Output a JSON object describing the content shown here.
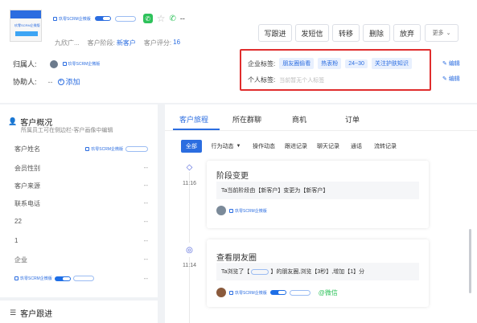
{
  "header": {
    "customer_short_name": "九欣广...",
    "stage_label": "客户阶段:",
    "stage_value": "新客户",
    "rating_label": "客户评分:",
    "rating_value": "16",
    "dash": "--",
    "avatar_text": "玖零SCRM企微版",
    "wecom_tag_text": "玖零SCRM企微版"
  },
  "owner": {
    "owner_label": "归属人:",
    "owner_tag_text": "玖零SCRM企微版",
    "assist_label": "协助人:",
    "assist_value": "--",
    "add_label": "添加"
  },
  "actions": {
    "buttons": [
      "写跟进",
      "发短信",
      "转移",
      "删除",
      "放弃"
    ],
    "more_label": "更多"
  },
  "tags": {
    "company_label": "企业标签:",
    "company_tags": [
      "朋友圈偷看",
      "热衷粉",
      "24~30",
      "关注护肤知识"
    ],
    "personal_label": "个人标签:",
    "personal_placeholder": "当前暂无个人标签",
    "edit_label": "编辑"
  },
  "overview": {
    "title": "客户概况",
    "subtitle": "所属员工可在侧边栏-客户画像中编辑",
    "rows": [
      {
        "label": "客户姓名",
        "value": ""
      },
      {
        "label": "会员性别",
        "value": "--"
      },
      {
        "label": "客户来源",
        "value": "--"
      },
      {
        "label": "联系电话",
        "value": "--"
      },
      {
        "label": "22",
        "value": "--"
      },
      {
        "label": "1",
        "value": "--"
      },
      {
        "label": "企业",
        "value": "--"
      },
      {
        "label": "",
        "value": "--"
      }
    ],
    "wecom_tag_text": "玖零SCRM企微版",
    "followup_title": "客户跟进"
  },
  "main": {
    "tabs": [
      "客户旅程",
      "所在群聊",
      "商机",
      "订单"
    ],
    "filters": [
      "全部",
      "行为动态",
      "操作动态",
      "跟进记录",
      "聊天记录",
      "通话",
      "流转记录"
    ],
    "events": [
      {
        "time": "11:16",
        "title": "阶段变更",
        "desc": "Ta当前阶段由【新客户】变更为【新客户】",
        "user_tag": "玖零SCRM企微版"
      },
      {
        "time": "11:14",
        "title": "查看朋友圈",
        "desc_pre": "Ta浏览了【",
        "desc_post": "】的朋友圈,浏览【3秒】,增加【1】分",
        "user_tag": "玖零SCRM企微版",
        "source": "@微信"
      }
    ]
  },
  "colors": {
    "accent": "#2b6de0",
    "highlight_border": "#e02d2d",
    "wechat_green": "#2ec25b"
  }
}
